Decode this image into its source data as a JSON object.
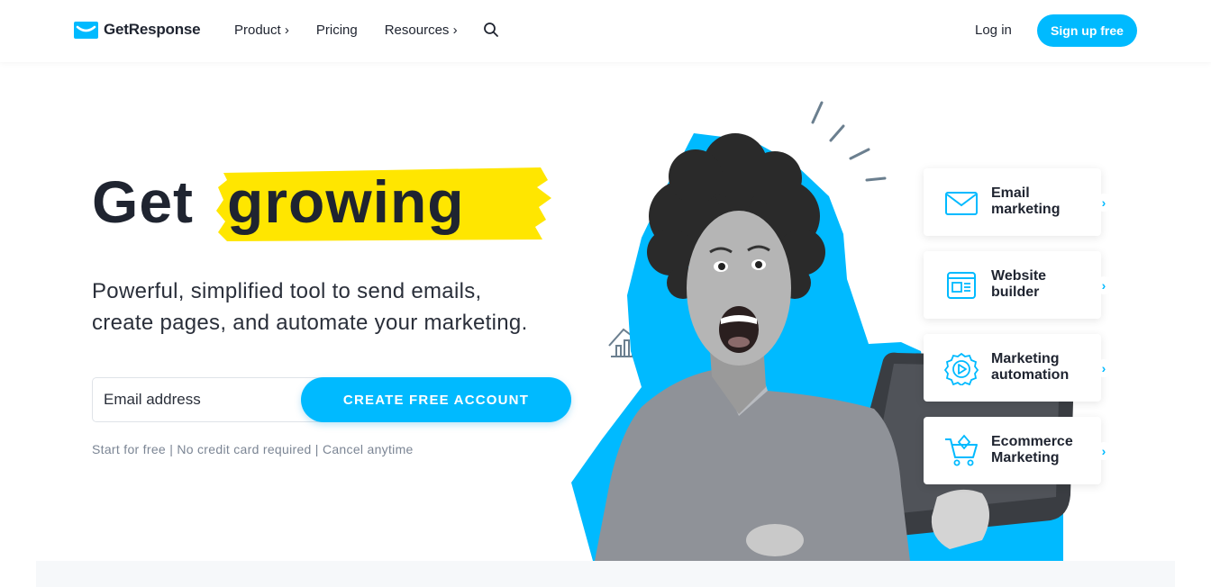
{
  "brand": {
    "name": "GetResponse",
    "accent": "#00baff",
    "highlight": "#ffe600"
  },
  "nav": {
    "items": [
      {
        "label": "Product ›"
      },
      {
        "label": "Pricing"
      },
      {
        "label": "Resources ›"
      }
    ],
    "search_icon": "search-icon",
    "login": "Log in",
    "signup": "Sign up free"
  },
  "hero": {
    "headline_plain": "Get",
    "headline_highlight": "growing",
    "subtitle_line1": "Powerful, simplified tool to send emails,",
    "subtitle_line2": "create pages, and automate your marketing.",
    "email_placeholder": "Email address",
    "cta": "CREATE FREE ACCOUNT",
    "fineprint": "Start for free | No credit card required | Cancel anytime"
  },
  "features": [
    {
      "label": "Email\nmarketing",
      "icon": "envelope-icon"
    },
    {
      "label": "Website\nbuilder",
      "icon": "website-icon"
    },
    {
      "label": "Marketing\nautomation",
      "icon": "gear-play-icon"
    },
    {
      "label": "Ecommerce\nMarketing",
      "icon": "cart-icon"
    }
  ],
  "chevron": "›"
}
